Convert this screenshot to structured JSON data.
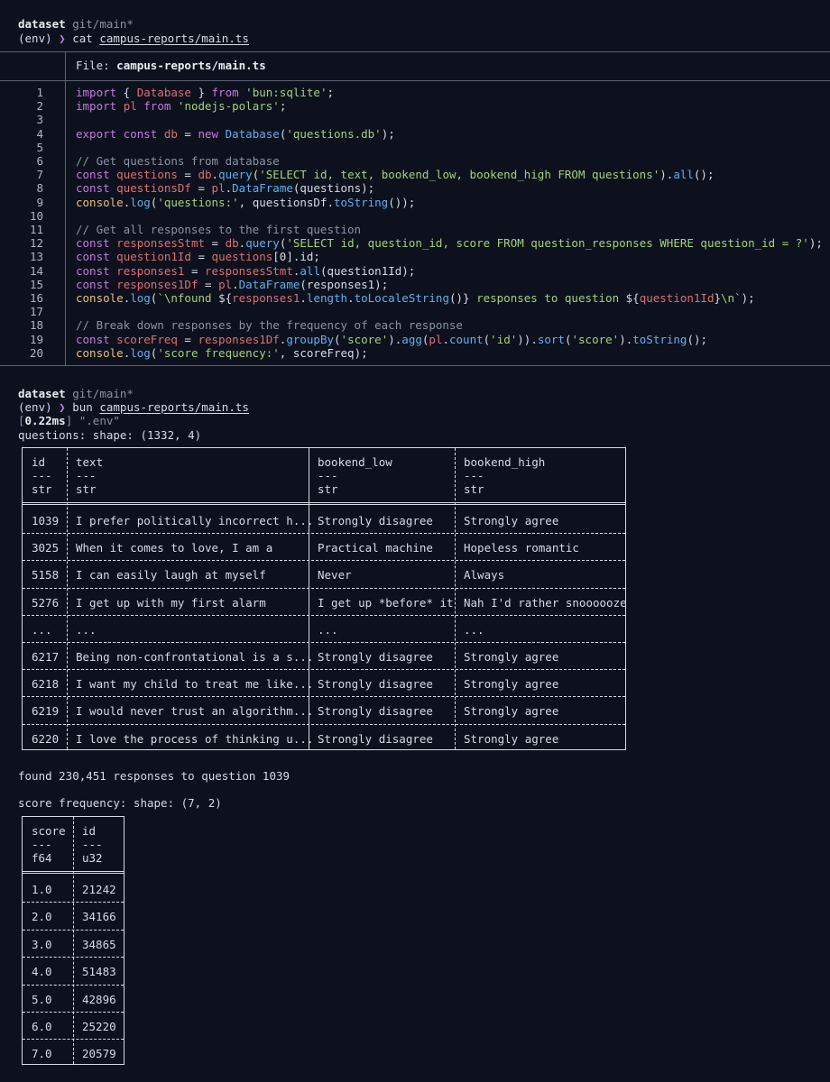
{
  "prompt1": {
    "dir": "dataset",
    "branch": "git/main*",
    "env": "(env)",
    "chevron": "❯",
    "cmd": "cat",
    "arg": "campus-reports/main.ts"
  },
  "file": {
    "label": "File:",
    "path": "campus-reports/main.ts"
  },
  "code_lines": [
    {
      "n": "1",
      "tokens": [
        [
          "kw",
          "import"
        ],
        [
          "plain",
          " { "
        ],
        [
          "cls",
          "Database"
        ],
        [
          "plain",
          " } "
        ],
        [
          "kw",
          "from"
        ],
        [
          "plain",
          " "
        ],
        [
          "str",
          "'bun:sqlite'"
        ],
        [
          "plain",
          ";"
        ]
      ]
    },
    {
      "n": "2",
      "tokens": [
        [
          "kw",
          "import"
        ],
        [
          "plain",
          " "
        ],
        [
          "cls",
          "pl"
        ],
        [
          "plain",
          " "
        ],
        [
          "kw",
          "from"
        ],
        [
          "plain",
          " "
        ],
        [
          "str",
          "'nodejs-polars'"
        ],
        [
          "plain",
          ";"
        ]
      ]
    },
    {
      "n": "3",
      "tokens": []
    },
    {
      "n": "4",
      "tokens": [
        [
          "kw",
          "export const"
        ],
        [
          "plain",
          " "
        ],
        [
          "cls",
          "db"
        ],
        [
          "plain",
          " = "
        ],
        [
          "kw",
          "new"
        ],
        [
          "plain",
          " "
        ],
        [
          "fn",
          "Database"
        ],
        [
          "plain",
          "("
        ],
        [
          "str",
          "'questions.db'"
        ],
        [
          "plain",
          ");"
        ]
      ]
    },
    {
      "n": "5",
      "tokens": []
    },
    {
      "n": "6",
      "tokens": [
        [
          "cm",
          "// Get questions from database"
        ]
      ]
    },
    {
      "n": "7",
      "tokens": [
        [
          "kw",
          "const"
        ],
        [
          "plain",
          " "
        ],
        [
          "cls",
          "questions"
        ],
        [
          "plain",
          " = "
        ],
        [
          "cls",
          "db"
        ],
        [
          "plain",
          "."
        ],
        [
          "fn",
          "query"
        ],
        [
          "plain",
          "("
        ],
        [
          "str",
          "'SELECT id, text, bookend_low, bookend_high FROM questions'"
        ],
        [
          "plain",
          ")."
        ],
        [
          "fn",
          "all"
        ],
        [
          "plain",
          "();"
        ]
      ]
    },
    {
      "n": "8",
      "tokens": [
        [
          "kw",
          "const"
        ],
        [
          "plain",
          " "
        ],
        [
          "cls",
          "questionsDf"
        ],
        [
          "plain",
          " = "
        ],
        [
          "cls",
          "pl"
        ],
        [
          "plain",
          "."
        ],
        [
          "fn",
          "DataFrame"
        ],
        [
          "plain",
          "(questions);"
        ]
      ]
    },
    {
      "n": "9",
      "tokens": [
        [
          "var",
          "console"
        ],
        [
          "plain",
          "."
        ],
        [
          "fn",
          "log"
        ],
        [
          "plain",
          "("
        ],
        [
          "str",
          "'questions:'"
        ],
        [
          "plain",
          ", questionsDf."
        ],
        [
          "fn",
          "toString"
        ],
        [
          "plain",
          "());"
        ]
      ]
    },
    {
      "n": "10",
      "tokens": []
    },
    {
      "n": "11",
      "tokens": [
        [
          "cm",
          "// Get all responses to the first question"
        ]
      ]
    },
    {
      "n": "12",
      "tokens": [
        [
          "kw",
          "const"
        ],
        [
          "plain",
          " "
        ],
        [
          "cls",
          "responsesStmt"
        ],
        [
          "plain",
          " = "
        ],
        [
          "cls",
          "db"
        ],
        [
          "plain",
          "."
        ],
        [
          "fn",
          "query"
        ],
        [
          "plain",
          "("
        ],
        [
          "str",
          "'SELECT id, question_id, score FROM question_responses WHERE question_id = ?'"
        ],
        [
          "plain",
          ");"
        ]
      ]
    },
    {
      "n": "13",
      "tokens": [
        [
          "kw",
          "const"
        ],
        [
          "plain",
          " "
        ],
        [
          "cls",
          "question1Id"
        ],
        [
          "plain",
          " = "
        ],
        [
          "cls",
          "questions"
        ],
        [
          "plain",
          "[0].id;"
        ]
      ]
    },
    {
      "n": "14",
      "tokens": [
        [
          "kw",
          "const"
        ],
        [
          "plain",
          " "
        ],
        [
          "cls",
          "responses1"
        ],
        [
          "plain",
          " = "
        ],
        [
          "cls",
          "responsesStmt"
        ],
        [
          "plain",
          "."
        ],
        [
          "fn",
          "all"
        ],
        [
          "plain",
          "(question1Id);"
        ]
      ]
    },
    {
      "n": "15",
      "tokens": [
        [
          "kw",
          "const"
        ],
        [
          "plain",
          " "
        ],
        [
          "cls",
          "responses1Df"
        ],
        [
          "plain",
          " = "
        ],
        [
          "cls",
          "pl"
        ],
        [
          "plain",
          "."
        ],
        [
          "fn",
          "DataFrame"
        ],
        [
          "plain",
          "(responses1);"
        ]
      ]
    },
    {
      "n": "16",
      "tokens": [
        [
          "var",
          "console"
        ],
        [
          "plain",
          "."
        ],
        [
          "fn",
          "log"
        ],
        [
          "plain",
          "("
        ],
        [
          "str",
          "`\\nfound "
        ],
        [
          "plain",
          "${"
        ],
        [
          "cls",
          "responses1"
        ],
        [
          "plain",
          "."
        ],
        [
          "fn",
          "length"
        ],
        [
          "plain",
          "."
        ],
        [
          "fn",
          "toLocaleString"
        ],
        [
          "plain",
          "()}"
        ],
        [
          "str",
          " responses to question "
        ],
        [
          "plain",
          "${"
        ],
        [
          "cls",
          "question1Id"
        ],
        [
          "plain",
          "}"
        ],
        [
          "str",
          "\\n`"
        ],
        [
          "plain",
          ");"
        ]
      ]
    },
    {
      "n": "17",
      "tokens": []
    },
    {
      "n": "18",
      "tokens": [
        [
          "cm",
          "// Break down responses by the frequency of each response"
        ]
      ]
    },
    {
      "n": "19",
      "tokens": [
        [
          "kw",
          "const"
        ],
        [
          "plain",
          " "
        ],
        [
          "cls",
          "scoreFreq"
        ],
        [
          "plain",
          " = "
        ],
        [
          "cls",
          "responses1Df"
        ],
        [
          "plain",
          "."
        ],
        [
          "fn",
          "groupBy"
        ],
        [
          "plain",
          "("
        ],
        [
          "str",
          "'score'"
        ],
        [
          "plain",
          ")."
        ],
        [
          "fn",
          "agg"
        ],
        [
          "plain",
          "("
        ],
        [
          "cls",
          "pl"
        ],
        [
          "plain",
          "."
        ],
        [
          "fn",
          "count"
        ],
        [
          "plain",
          "("
        ],
        [
          "str",
          "'id'"
        ],
        [
          "plain",
          "))."
        ],
        [
          "fn",
          "sort"
        ],
        [
          "plain",
          "("
        ],
        [
          "str",
          "'score'"
        ],
        [
          "plain",
          ")."
        ],
        [
          "fn",
          "toString"
        ],
        [
          "plain",
          "();"
        ]
      ]
    },
    {
      "n": "20",
      "tokens": [
        [
          "var",
          "console"
        ],
        [
          "plain",
          "."
        ],
        [
          "fn",
          "log"
        ],
        [
          "plain",
          "("
        ],
        [
          "str",
          "'score frequency:'"
        ],
        [
          "plain",
          ", scoreFreq);"
        ]
      ]
    }
  ],
  "prompt2": {
    "dir": "dataset",
    "branch": "git/main*",
    "env": "(env)",
    "chevron": "❯",
    "cmd": "bun",
    "arg": "campus-reports/main.ts"
  },
  "timing": {
    "open": "[",
    "ms": "0.22ms",
    "close": "]",
    "rest": " \".env\""
  },
  "questions_label": "questions: shape: (1332, 4)",
  "questions_table": {
    "columns": [
      {
        "name": "id",
        "sep": "---",
        "dtype": "str"
      },
      {
        "name": "text",
        "sep": "---",
        "dtype": "str"
      },
      {
        "name": "bookend_low",
        "sep": "---",
        "dtype": "str"
      },
      {
        "name": "bookend_high",
        "sep": "---",
        "dtype": "str"
      }
    ],
    "rows": [
      [
        "1039",
        "I prefer politically incorrect h...",
        "Strongly disagree",
        "Strongly agree"
      ],
      [
        "3025",
        "When it comes to love, I am a",
        "Practical machine",
        "Hopeless romantic"
      ],
      [
        "5158",
        "I can easily laugh at myself",
        "Never",
        "Always"
      ],
      [
        "5276",
        "I get up with my first alarm",
        "I get up *before* it",
        "Nah I'd rather snoooooze"
      ],
      [
        "...",
        "...",
        "...",
        "..."
      ],
      [
        "6217",
        "Being non-confrontational is a s...",
        "Strongly disagree",
        "Strongly agree"
      ],
      [
        "6218",
        "I want my child to treat me like...",
        "Strongly disagree",
        "Strongly agree"
      ],
      [
        "6219",
        "I would never trust an algorithm...",
        "Strongly disagree",
        "Strongly agree"
      ],
      [
        "6220",
        "I love the process of thinking u...",
        "Strongly disagree",
        "Strongly agree"
      ]
    ]
  },
  "found_line": "found 230,451 responses to question 1039",
  "score_label": "score frequency: shape: (7, 2)",
  "score_table": {
    "columns": [
      {
        "name": "score",
        "sep": "---",
        "dtype": "f64"
      },
      {
        "name": "id",
        "sep": "---",
        "dtype": "u32"
      }
    ],
    "rows": [
      [
        "1.0",
        "21242"
      ],
      [
        "2.0",
        "34166"
      ],
      [
        "3.0",
        "34865"
      ],
      [
        "4.0",
        "51483"
      ],
      [
        "5.0",
        "42896"
      ],
      [
        "6.0",
        "25220"
      ],
      [
        "7.0",
        "20579"
      ]
    ]
  }
}
